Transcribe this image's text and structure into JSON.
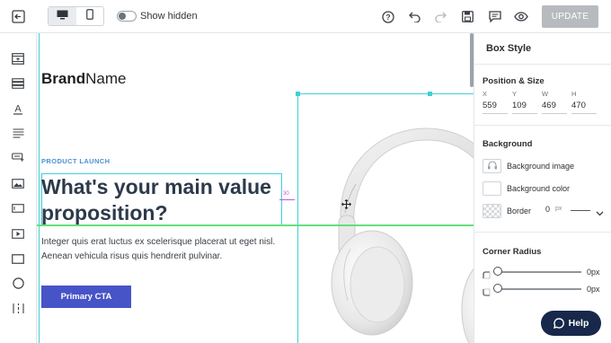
{
  "toolbar": {
    "show_hidden_label": "Show hidden",
    "update_label": "UPDATE",
    "icons": [
      "exit-icon",
      "desktop-icon",
      "mobile-icon",
      "help-circle-icon",
      "undo-icon",
      "redo-icon",
      "save-icon",
      "comment-icon",
      "preview-eye-icon"
    ]
  },
  "toolstrip": {
    "tools": [
      "section-tool-icon",
      "rows-tool-icon",
      "text-tool-icon",
      "paragraph-tool-icon",
      "button-tool-icon",
      "image-tool-icon",
      "input-tool-icon",
      "video-tool-icon",
      "box-tool-icon",
      "circle-tool-icon",
      "spacer-tool-icon"
    ]
  },
  "canvas": {
    "brand_bold": "Brand",
    "brand_regular": "Name",
    "eyebrow": "PRODUCT LAUNCH",
    "headline": "What's your main value proposition?",
    "body": "Integer quis erat luctus ex scelerisque placerat ut eget nisl. Aenean vehicula risus quis hendrerit pulvinar.",
    "cta_label": "Primary CTA",
    "spacing_value": "30"
  },
  "panel": {
    "title": "Box Style",
    "position_size": {
      "title": "Position & Size",
      "fields": [
        {
          "label": "X",
          "value": "559"
        },
        {
          "label": "Y",
          "value": "109"
        },
        {
          "label": "W",
          "value": "469"
        },
        {
          "label": "H",
          "value": "470"
        }
      ]
    },
    "background": {
      "title": "Background",
      "image_label": "Background image",
      "color_label": "Background color",
      "border_label": "Border",
      "border_value": "0",
      "border_unit": "px"
    },
    "corner_radius": {
      "title": "Corner Radius",
      "rows": [
        {
          "value": "0px"
        },
        {
          "value": "0px"
        }
      ]
    }
  },
  "help": {
    "label": "Help"
  },
  "colors": {
    "accent_cyan": "#3fd0d6",
    "cta_blue": "#4754c7",
    "guide_green": "#63e07a",
    "help_navy": "#17284a",
    "update_disabled": "#b7bbc0"
  }
}
